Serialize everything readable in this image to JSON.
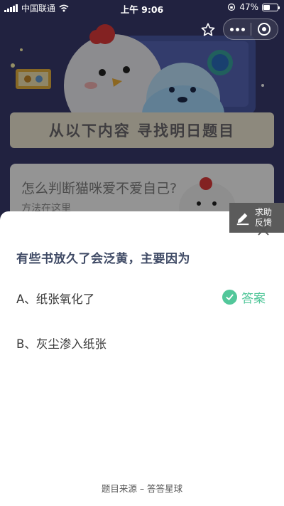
{
  "status_bar": {
    "carrier": "中国联通",
    "time": "上午 9:06",
    "battery": "47%",
    "battery_level": 0.47
  },
  "nav": {
    "star_icon": "star-outline-icon",
    "more_icon": "more-dots-icon",
    "close_icon": "close-circle-icon"
  },
  "background": {
    "banner_title": "从以下内容 寻找明日题目",
    "question": "怎么判断猫咪爱不爱自己?",
    "subtext": "方法在这里"
  },
  "help": {
    "line1": "求助",
    "line2": "反馈",
    "icon": "pencil-icon"
  },
  "quiz": {
    "question": "有些书放久了会泛黄，主要因为",
    "options": [
      {
        "label": "A、纸张氧化了",
        "is_answer": true
      },
      {
        "label": "B、灰尘渗入纸张",
        "is_answer": false
      }
    ],
    "answer_label": "答案",
    "source": "题目来源 – 答答星球"
  },
  "colors": {
    "accent_green": "#52c79a",
    "question_color": "#404b66",
    "background_dark": "#2c2d52"
  }
}
